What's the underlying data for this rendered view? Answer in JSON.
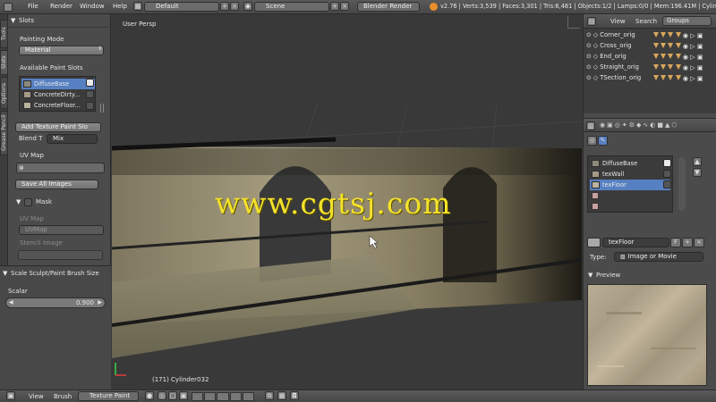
{
  "topbar": {
    "menus": [
      "File",
      "Render",
      "Window",
      "Help"
    ],
    "layout": "Default",
    "scene": "Scene",
    "engine": "Blender Render",
    "stats": "v2.76 | Verts:3,539 | Faces:3,301 | Tris:6,481 | Objects:1/2 | Lamps:0/0 | Mem:196.41M | Cylin"
  },
  "tabs": [
    "Tools",
    "Slots",
    "Options",
    "Grease Pencil"
  ],
  "slots_panel": {
    "header": "Slots",
    "painting_mode_label": "Painting Mode",
    "painting_mode_value": "Material",
    "available_label": "Available Paint Slots",
    "slots": [
      "DiffuseBase",
      "ConcreteDirty...",
      "ConcreteFloor..."
    ],
    "add_texture": "Add Texture Paint Slo",
    "blend_label": "Blend T",
    "blend_value": "Mix",
    "uvmap_label": "UV Map",
    "save_all": "Save All Images",
    "mask_header": "Mask",
    "mask_uvmap_label": "UV Map",
    "mask_uvmap_value": "UVMap",
    "stencil_label": "Stencil Image",
    "scale_header": "Scale Sculpt/Paint Brush Size",
    "scalar_label": "Scalar",
    "scalar_value": "0.900"
  },
  "viewport": {
    "view_label": "User Persp",
    "object_label": "(171) Cylinder032",
    "watermark": "www.cgtsj.com"
  },
  "outliner": {
    "tabs": [
      "View",
      "Search",
      "Groups"
    ],
    "items": [
      "Corner_orig",
      "Cross_orig",
      "End_orig",
      "Straight_orig",
      "TSection_orig"
    ]
  },
  "properties": {
    "textures": [
      "DiffuseBase",
      "texWall",
      "texFloor"
    ],
    "selected_texture": "texFloor",
    "texture_name": "texFloor",
    "texture_flag": "F",
    "type_label": "Type:",
    "type_value": "Image or Movie",
    "preview_label": "Preview"
  },
  "bottombar": {
    "view": "View",
    "brush": "Brush",
    "mode": "Texture Paint"
  }
}
